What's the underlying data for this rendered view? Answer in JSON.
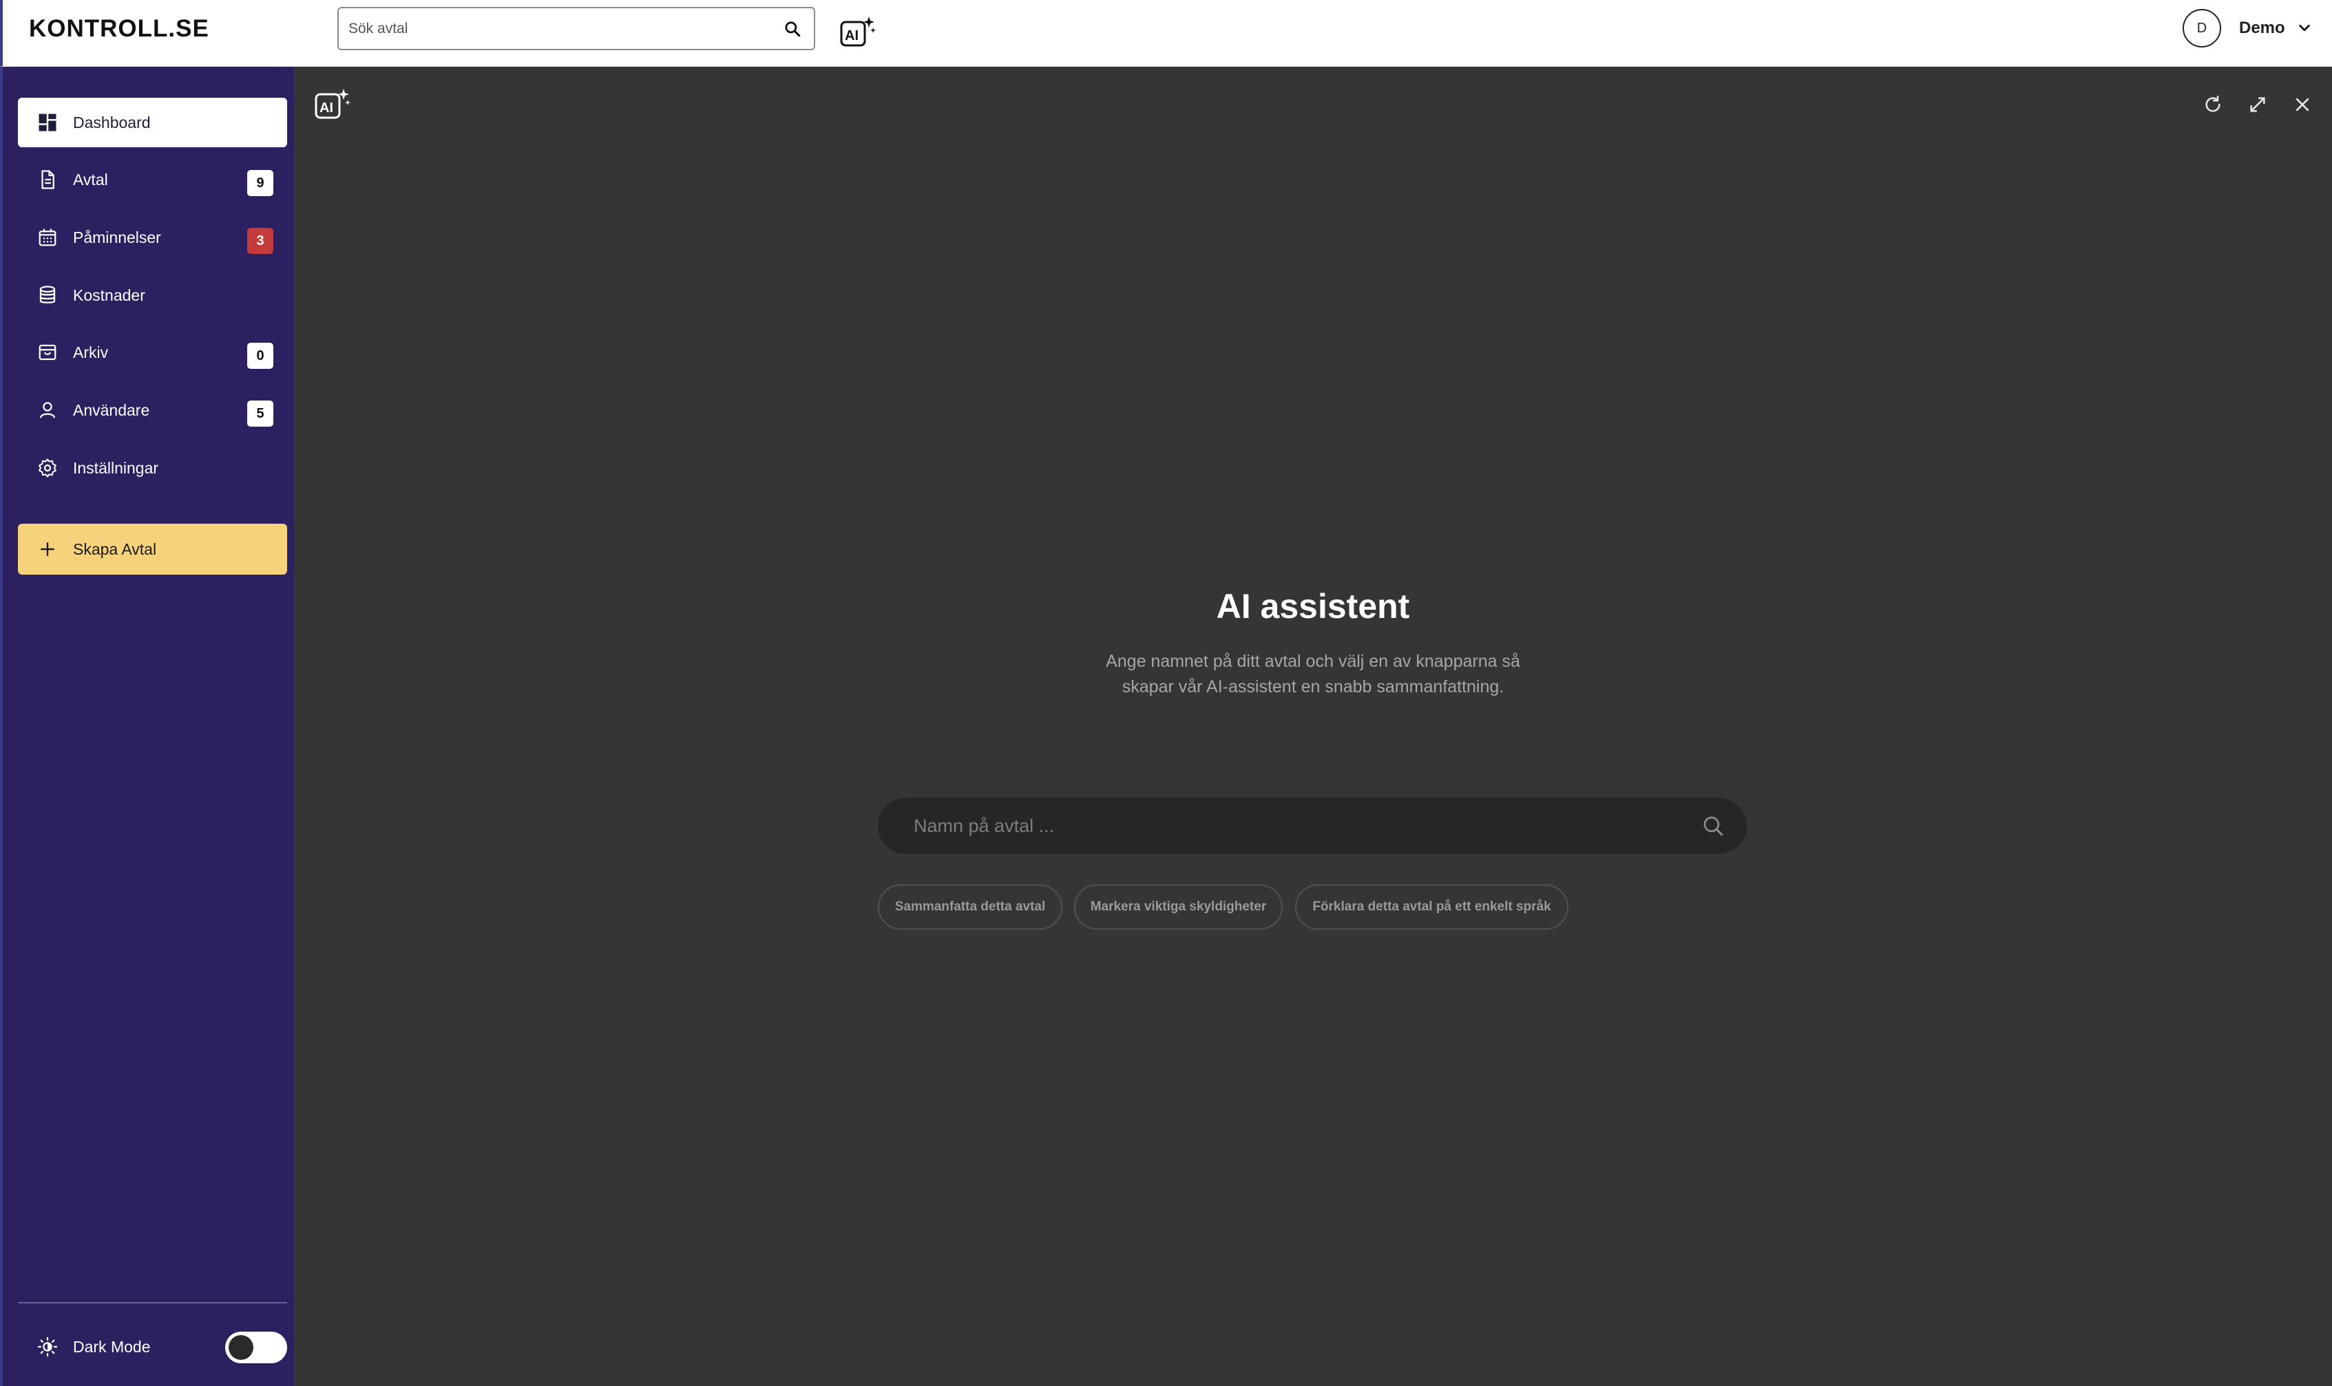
{
  "topbar": {
    "logo": "KONTROLL.SE",
    "search_placeholder": "Sök avtal",
    "user": {
      "initial": "D",
      "name": "Demo"
    }
  },
  "sidebar": {
    "items": [
      {
        "label": "Dashboard",
        "icon": "dashboard-icon",
        "active": true
      },
      {
        "label": "Avtal",
        "icon": "document-icon",
        "badge": "9"
      },
      {
        "label": "Påminnelser",
        "icon": "calendar-icon",
        "badge": "3",
        "badge_color": "#c43b3b"
      },
      {
        "label": "Kostnader",
        "icon": "database-icon"
      },
      {
        "label": "Arkiv",
        "icon": "archive-icon",
        "badge": "0"
      },
      {
        "label": "Användare",
        "icon": "user-icon",
        "badge": "5"
      },
      {
        "label": "Inställningar",
        "icon": "gear-icon"
      }
    ],
    "create_button": "Skapa Avtal",
    "dark_mode_label": "Dark Mode",
    "dark_mode_on": false
  },
  "panel": {
    "title": "AI assistent",
    "subtitle_line1": "Ange namnet på ditt avtal och välj en av knapparna så",
    "subtitle_line2": "skapar vår AI-assistent en snabb sammanfattning.",
    "search_placeholder": "Namn på avtal ...",
    "chips": [
      "Sammanfatta detta avtal",
      "Markera viktiga skyldigheter",
      "Förklara detta avtal på ett enkelt språk"
    ]
  },
  "colors": {
    "sidebar_bg": "#2d2060",
    "panel_bg": "#353535",
    "accent_yellow": "#f6d27a",
    "badge_red": "#c43b3b"
  }
}
